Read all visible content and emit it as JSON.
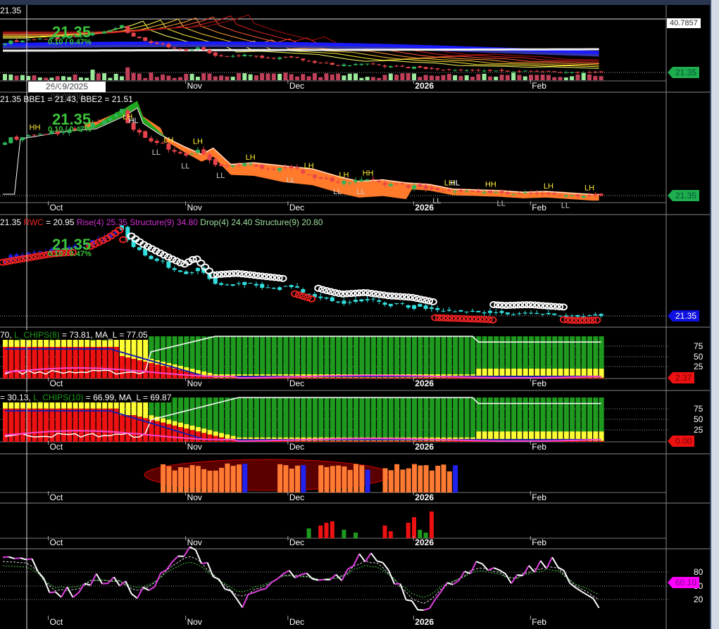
{
  "panels": {
    "p1": {
      "last": "21.35",
      "big_price": "21.35",
      "change": "0.10 / 0.47%",
      "axis_top": "40.7857",
      "price_tag": "21.35",
      "crosshair_date": "26/09/2025 00:00:00"
    },
    "p2": {
      "title": "21.35 BBE1 = 21.43, BBE2 = 21.51",
      "big_price": "21.35",
      "change": "0.10 / 0.47%",
      "price_tag": "21.35"
    },
    "p3": {
      "t1": "21.35 ",
      "t2": "RWC",
      "t3": " = 20.95 ",
      "t4": "Rise(4) 25.35 Structure(9) 34.80",
      "t5": " Drop(4) 24.40 Structure(9) 20.80",
      "big_price": "21.35",
      "change": "0.10 / 0.47%",
      "price_tag": "21.35"
    },
    "p4": {
      "t1": "70, ",
      "t2": "L_CHIPS(8)",
      "t3": " = 73.81, MA_L = 77.05",
      "ticks": [
        "75",
        "50",
        "25"
      ],
      "tag": "2.37"
    },
    "p5": {
      "t1": "= 30.13, ",
      "t2": "L_CHIPS(10)",
      "t3": " = 66.99, MA_L = 69.87",
      "ticks": [
        "75",
        "50",
        "25"
      ],
      "tag": "0.00"
    },
    "p8": {
      "ticks": [
        "80",
        "50",
        "20"
      ],
      "tag": "60.10"
    }
  },
  "colors": {
    "up": "#2fb55a",
    "down": "#e8434b",
    "tag_green": "#1fae4f",
    "tag_blue": "#1010e0",
    "tag_red": "#ee1111",
    "tag_magenta": "#ff00ff"
  },
  "chart_data": {
    "type": "candlestick",
    "x_ticks": [
      {
        "label": "Oct",
        "i": 8.5
      },
      {
        "label": "Nov",
        "i": 32
      },
      {
        "label": "Dec",
        "i": 49.5
      },
      {
        "label": "2026",
        "i": 71
      },
      {
        "label": "Feb",
        "i": 91
      }
    ],
    "price_keypoints": [
      [
        0,
        28.5
      ],
      [
        8,
        29.5
      ],
      [
        13,
        29.8
      ],
      [
        18,
        31.5
      ],
      [
        20,
        32.5
      ],
      [
        21,
        30.5
      ],
      [
        24,
        29
      ],
      [
        28,
        27.5
      ],
      [
        31,
        26.5
      ],
      [
        33,
        27.3
      ],
      [
        36,
        25.2
      ],
      [
        40,
        25.4
      ],
      [
        45,
        25
      ],
      [
        50,
        24.6
      ],
      [
        55,
        23.5
      ],
      [
        58,
        23
      ],
      [
        62,
        23.2
      ],
      [
        66,
        22.8
      ],
      [
        70,
        22.6
      ],
      [
        74,
        22
      ],
      [
        78,
        21.9
      ],
      [
        82,
        21.8
      ],
      [
        86,
        21.6
      ],
      [
        90,
        21.7
      ],
      [
        94,
        21.5
      ],
      [
        98,
        21.3
      ],
      [
        102,
        21.35
      ]
    ],
    "last_close": 21.35,
    "structure_labels": [
      [
        5,
        "HH"
      ],
      [
        21,
        "LH"
      ],
      [
        22,
        "HL"
      ],
      [
        26,
        "LL"
      ],
      [
        28,
        "LH"
      ],
      [
        31,
        "LL"
      ],
      [
        33,
        "LH"
      ],
      [
        37,
        "LL"
      ],
      [
        42,
        "LH"
      ],
      [
        49,
        "LL"
      ],
      [
        52,
        "LH"
      ],
      [
        57,
        "LL"
      ],
      [
        58,
        "LH"
      ],
      [
        61,
        "LL"
      ],
      [
        62,
        "HH"
      ],
      [
        74,
        "LL"
      ],
      [
        76,
        "LH"
      ],
      [
        77,
        "HL"
      ],
      [
        83,
        "HH"
      ],
      [
        85,
        "LL"
      ],
      [
        93,
        "LH"
      ],
      [
        96,
        "LL"
      ],
      [
        100,
        "LH"
      ]
    ],
    "oscillator_levels": [
      80,
      50,
      20
    ],
    "chips_levels": [
      75,
      50,
      25
    ]
  }
}
